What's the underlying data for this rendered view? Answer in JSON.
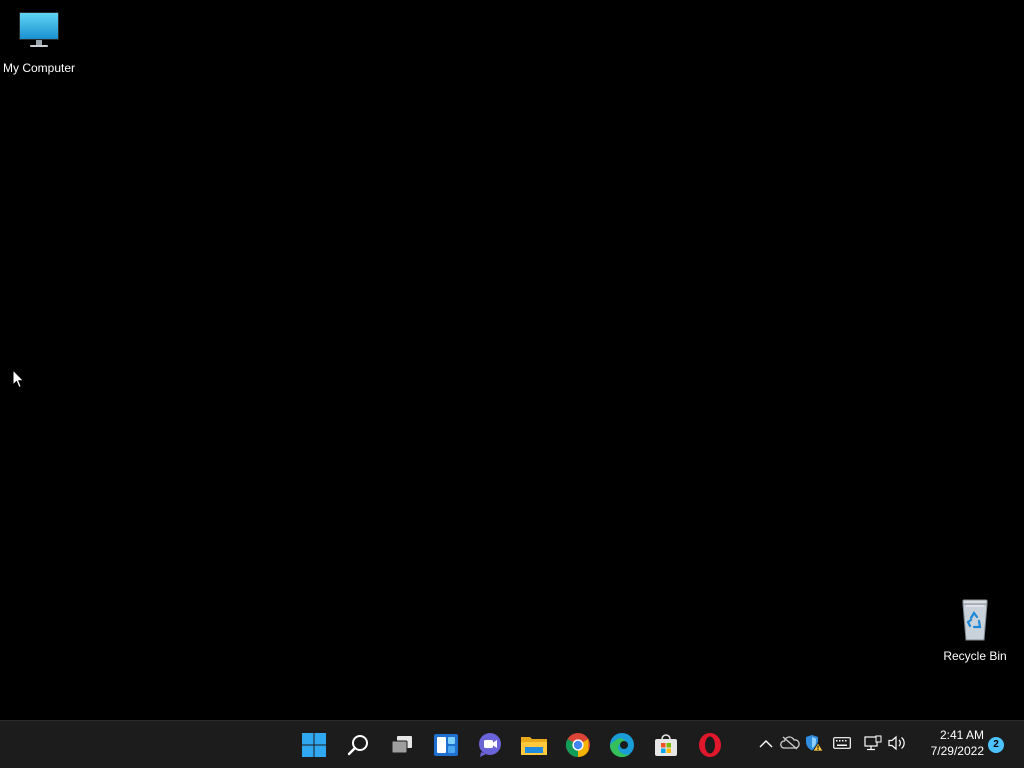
{
  "desktop": {
    "icons": [
      {
        "label": "My Computer",
        "icon": "monitor-icon"
      },
      {
        "label": "Recycle Bin",
        "icon": "recycle-bin-icon"
      }
    ]
  },
  "taskbar": {
    "apps": [
      {
        "name": "Start",
        "icon": "windows-logo-icon"
      },
      {
        "name": "Search",
        "icon": "search-icon"
      },
      {
        "name": "Task View",
        "icon": "task-view-icon"
      },
      {
        "name": "Widgets",
        "icon": "widgets-icon"
      },
      {
        "name": "Chat",
        "icon": "chat-icon"
      },
      {
        "name": "File Explorer",
        "icon": "folder-icon"
      },
      {
        "name": "Google Chrome",
        "icon": "chrome-icon"
      },
      {
        "name": "Microsoft Edge",
        "icon": "edge-icon"
      },
      {
        "name": "Microsoft Store",
        "icon": "store-icon"
      },
      {
        "name": "Opera",
        "icon": "opera-icon"
      }
    ],
    "tray": {
      "icons": [
        "chevron-up-icon",
        "onedrive-icon",
        "security-warning-icon",
        "keyboard-icon",
        "network-icon",
        "volume-icon"
      ],
      "time": "2:41 AM",
      "date": "7/29/2022",
      "notification_count": "2"
    }
  },
  "colors": {
    "desktop_bg": "#000000",
    "taskbar_bg": "#1c1c1c",
    "accent": "#4cc2ff"
  }
}
